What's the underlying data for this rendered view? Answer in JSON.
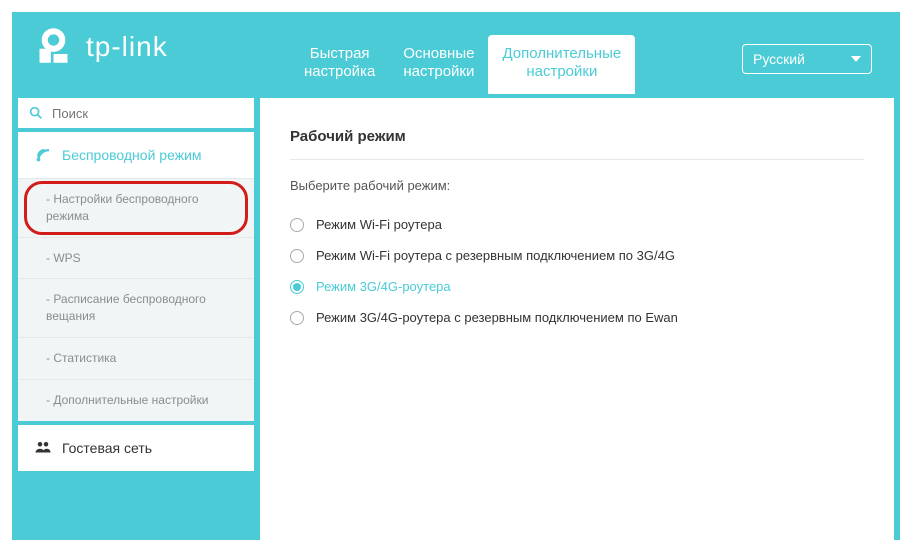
{
  "brand": "tp-link",
  "tabs": {
    "quick": "Быстрая\nнастройка",
    "basic": "Основные\nнастройки",
    "advanced": "Дополнительные\nнастройки"
  },
  "language": "Русский",
  "search": {
    "placeholder": "Поиск"
  },
  "sidebar": {
    "wireless": {
      "label": "Беспроводной режим",
      "items": [
        "- Настройки беспроводного режима",
        "- WPS",
        "- Расписание беспроводного вещания",
        "- Статистика",
        "- Дополнительные настройки"
      ]
    },
    "guest": {
      "label": "Гостевая сеть"
    }
  },
  "content": {
    "title": "Рабочий режим",
    "prompt": "Выберите рабочий режим:",
    "options": [
      "Режим Wi-Fi роутера",
      "Режим Wi-Fi роутера с резервным подключением по 3G/4G",
      "Режим 3G/4G-роутера",
      "Режим 3G/4G-роутера с резервным подключением по Ewan"
    ],
    "selected_index": 2
  }
}
